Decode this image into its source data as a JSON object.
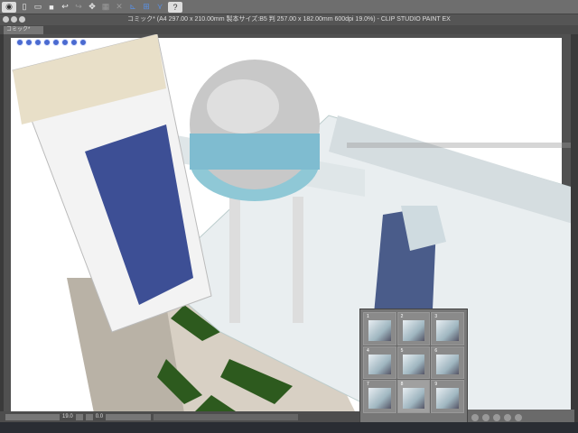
{
  "toolbar": {
    "icons": [
      "eye-icon",
      "new-icon",
      "open-icon",
      "save-icon",
      "undo-icon",
      "redo-icon",
      "transform-icon",
      "select-icon",
      "snap-ruler-icon",
      "snap-grid-icon",
      "snap-perspective-icon",
      "help-icon"
    ]
  },
  "window": {
    "title": "コミック* (A4 297.00 x 210.00mm 製本サイズ:B5 判 257.00 x 182.00mm 600dpi 19.0%)  - CLIP STUDIO PAINT EX"
  },
  "tab": {
    "label": "コミック*"
  },
  "status": {
    "zoom": "19.0",
    "angle": "0.0"
  },
  "thumbnails": [
    {
      "n": "1"
    },
    {
      "n": "2"
    },
    {
      "n": "3"
    },
    {
      "n": "4"
    },
    {
      "n": "5"
    },
    {
      "n": "6"
    },
    {
      "n": "7"
    },
    {
      "n": "8"
    },
    {
      "n": "9"
    }
  ],
  "colors": {
    "accent": "#4a6ad0",
    "grass": "#2d5a1e",
    "sky": "#ffffff"
  }
}
